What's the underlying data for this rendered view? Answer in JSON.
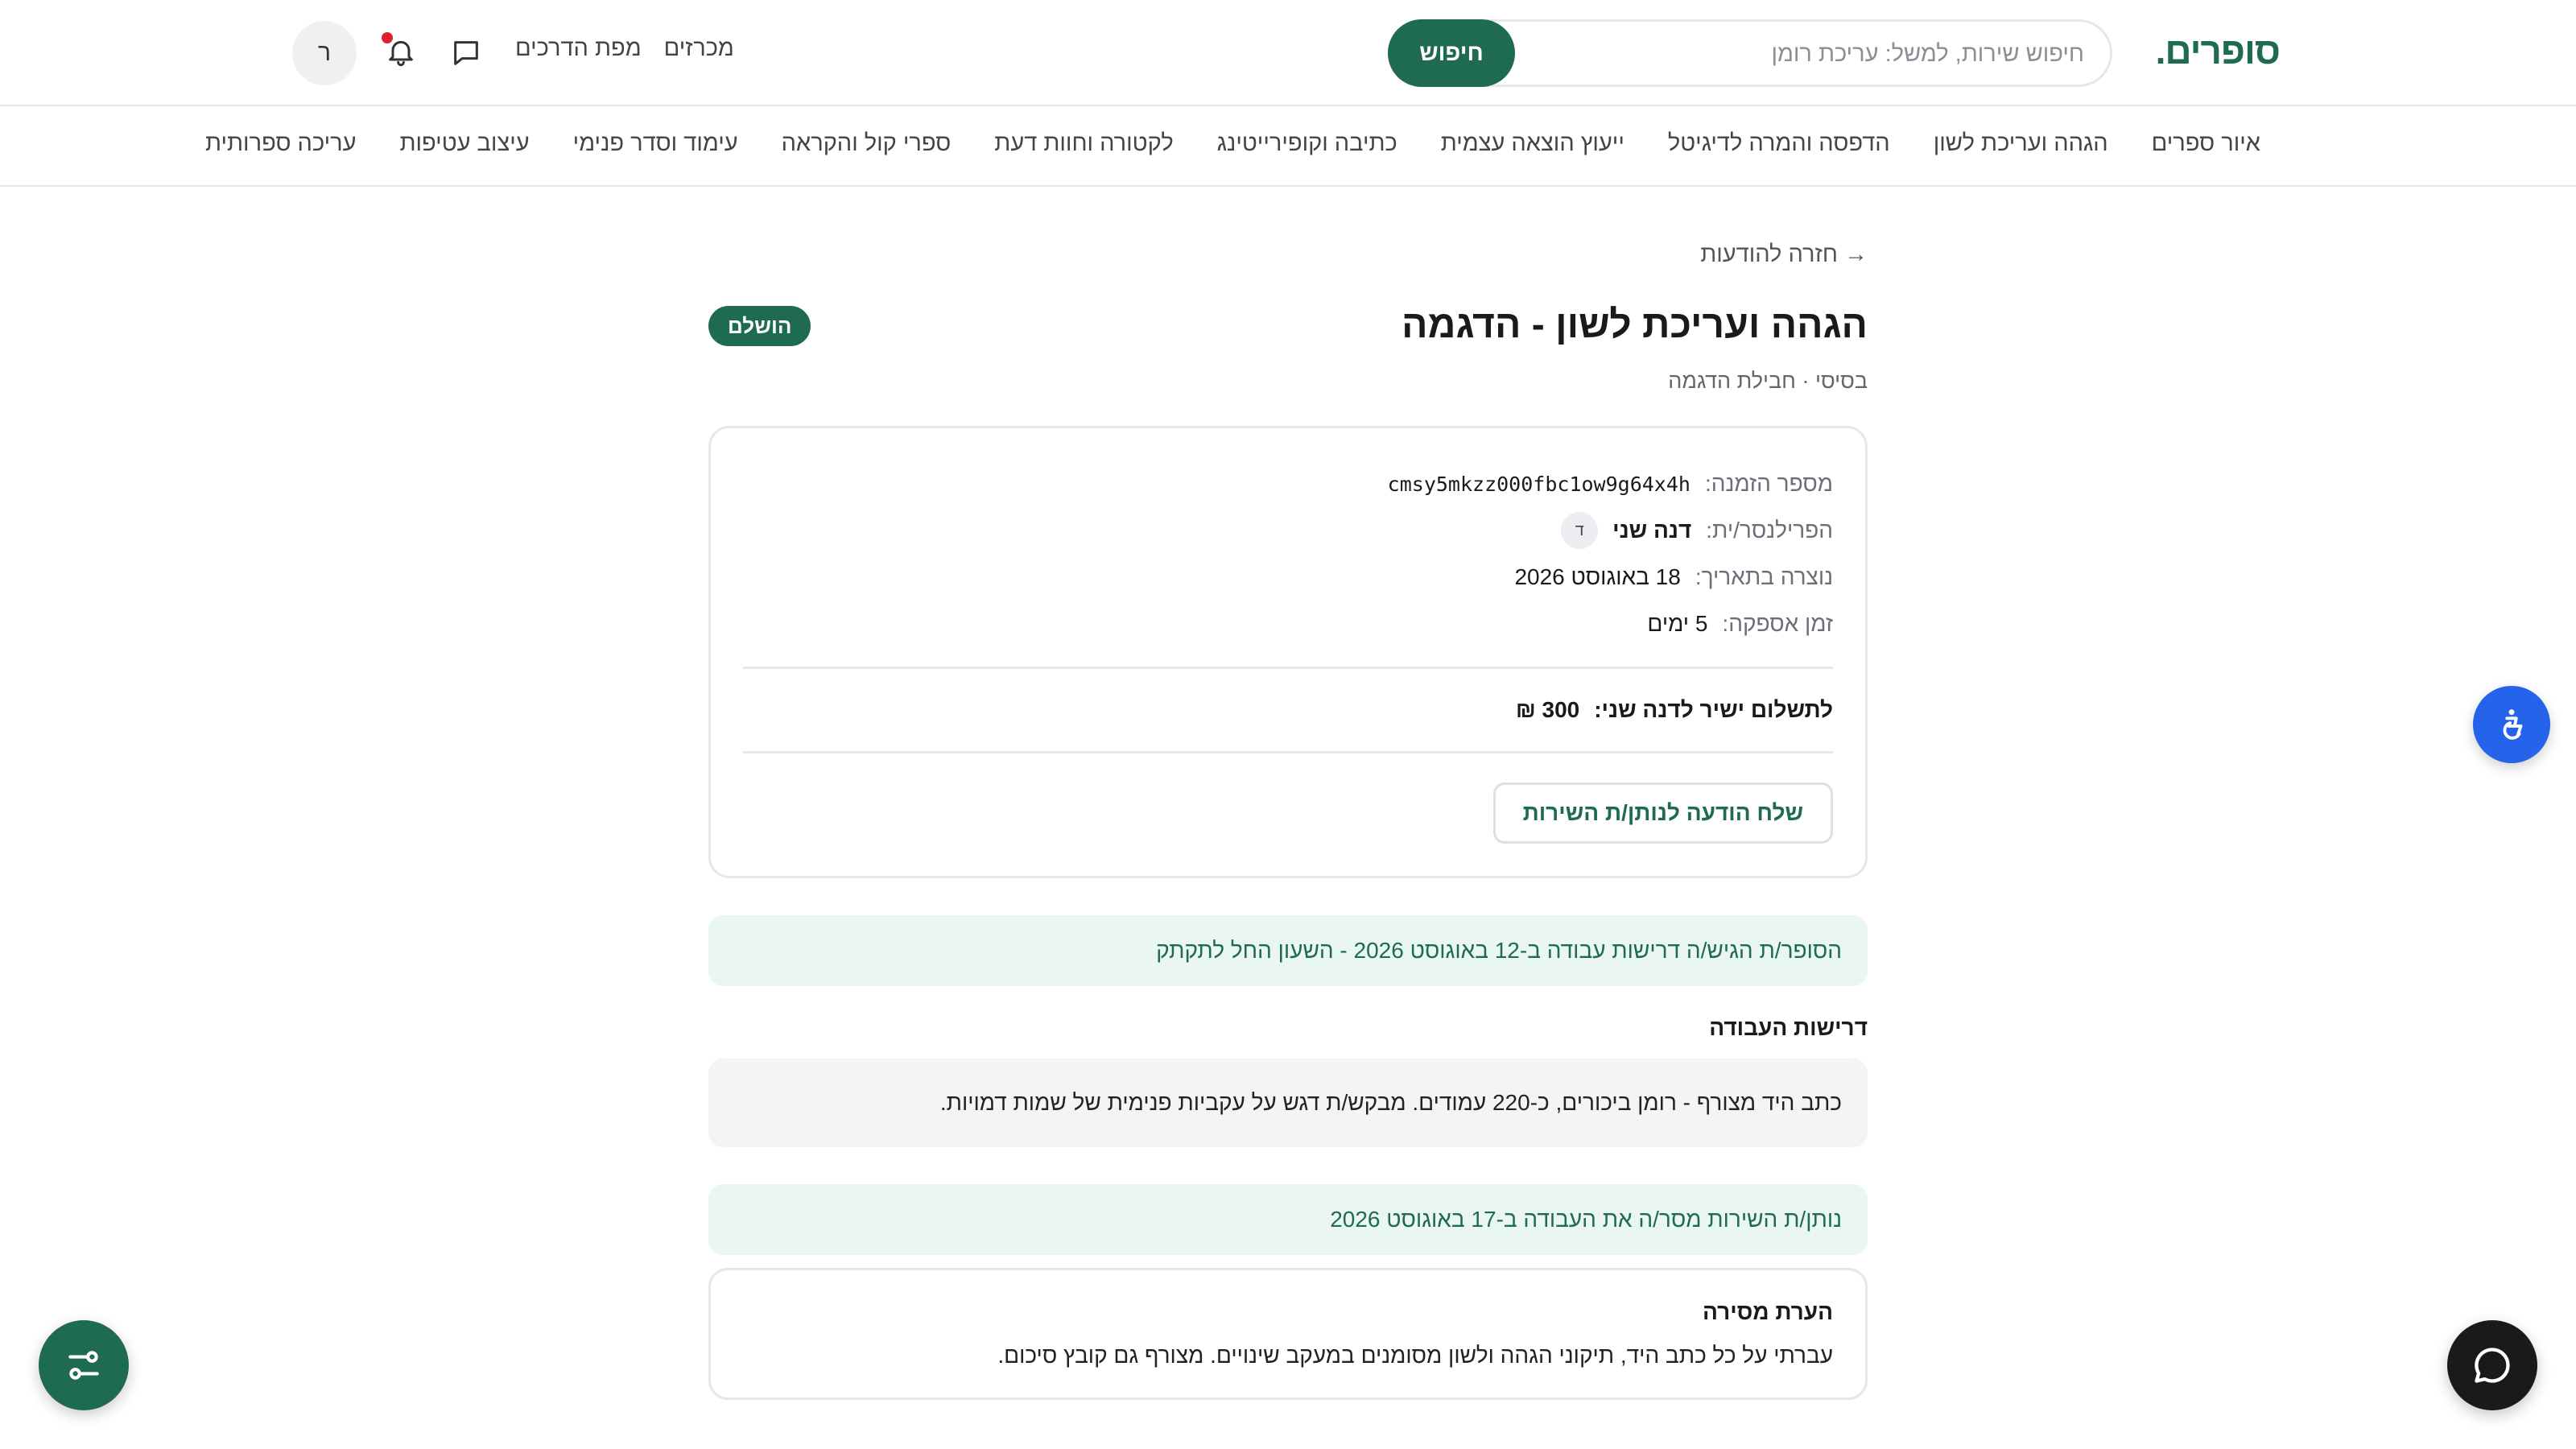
{
  "header": {
    "logo": "סופרים.",
    "search": {
      "placeholder": "חיפוש שירות, למשל: עריכת רומן",
      "button": "חיפוש"
    },
    "links": [
      "מכרזים",
      "מפת הדרכים"
    ],
    "user_initial": "ר"
  },
  "categories": [
    "איור ספרים",
    "הגהה ועריכת לשון",
    "הדפסה והמרה לדיגיטל",
    "ייעוץ הוצאה עצמית",
    "כתיבה וקופירייטינג",
    "לקטורה וחוות דעת",
    "ספרי קול והקראה",
    "עימוד וסדר פנימי",
    "עיצוב עטיפות",
    "עריכה ספרותית"
  ],
  "order": {
    "back_link": "→ חזרה להודעות",
    "title": "הגהה ועריכת לשון - הדגמה",
    "status": "הושלם",
    "subtitle": "בסיסי · חבילת הדגמה",
    "order_number_label": "מספר הזמנה:",
    "order_number": "cmsy5mkzz000fbc1ow9g64x4h",
    "freelancer_label": "הפרילנסר/ית:",
    "freelancer_name": "דנה שני",
    "freelancer_initial": "ד",
    "created_label": "נוצרה בתאריך:",
    "created_date": "18 באוגוסט 2026",
    "delivery_label": "זמן אספקה:",
    "delivery_time": "5 ימים",
    "payment_label": "לתשלום ישיר לדנה שני:",
    "payment_amount": "300 ₪",
    "message_button": "שלח הודעה לנותן/ת השירות"
  },
  "timeline": {
    "submitted_event": "הסופר/ת הגיש/ה דרישות עבודה ב-12 באוגוסט 2026 - השעון החל לתקתק",
    "requirements_heading": "דרישות העבודה",
    "requirements_text": "כתב היד מצורף - רומן ביכורים, כ-220 עמודים. מבקש/ת דגש על עקביות פנימית של שמות דמויות.",
    "delivered_event": "נותן/ת השירות מסר/ה את העבודה ב-17 באוגוסט 2026",
    "delivery_note_title": "הערת מסירה",
    "delivery_note_text": "עברתי על כל כתב היד, תיקוני הגהה ולשון מסומנים במעקב שינויים. מצורף גם קובץ סיכום."
  },
  "colors": {
    "brand": "#1f6b4f",
    "accessibility": "#2563eb",
    "notification": "#e11d2e"
  },
  "icons": [
    "bell-icon",
    "chat-icon",
    "accessibility-icon",
    "filters-icon",
    "support-chat-icon"
  ]
}
